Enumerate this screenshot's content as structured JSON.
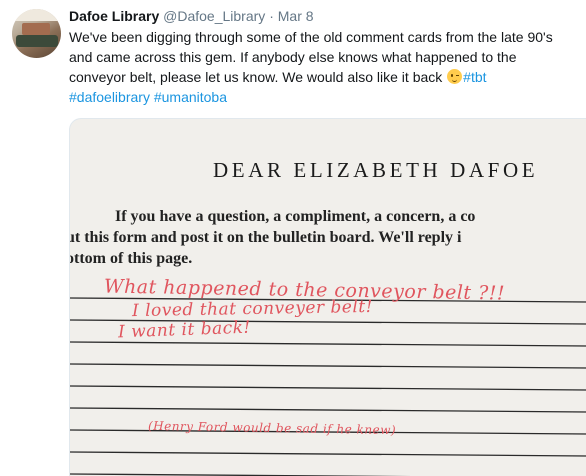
{
  "tweet": {
    "display_name": "Dafoe Library",
    "handle": "@Dafoe_Library",
    "separator": "·",
    "date": "Mar 8",
    "text_lines": [
      "We've been digging through some of the old comment cards from the late 90's",
      "and came across this gem. If anybody else knows what happened to the",
      "conveyor belt, please let us know. We would also like it back"
    ],
    "emoji": "winking-face",
    "hashtag_inline": "#tbt",
    "hashtags": [
      "#dafoelibrary",
      "#umanitoba"
    ]
  },
  "card": {
    "title": "DEAR ELIZABETH DAFOE",
    "body_lines": [
      "If you have a question, a compliment, a concern, a co",
      "ut this form and post it on the bulletin board.  We'll reply i",
      "ottom of this page."
    ],
    "handwriting": [
      "What happened to the conveyor belt ?!!",
      "I loved that conveyer belt!",
      "I want it back!",
      "(Henry Ford would be sad if he knew)"
    ],
    "ink_color": "#e0555e"
  }
}
